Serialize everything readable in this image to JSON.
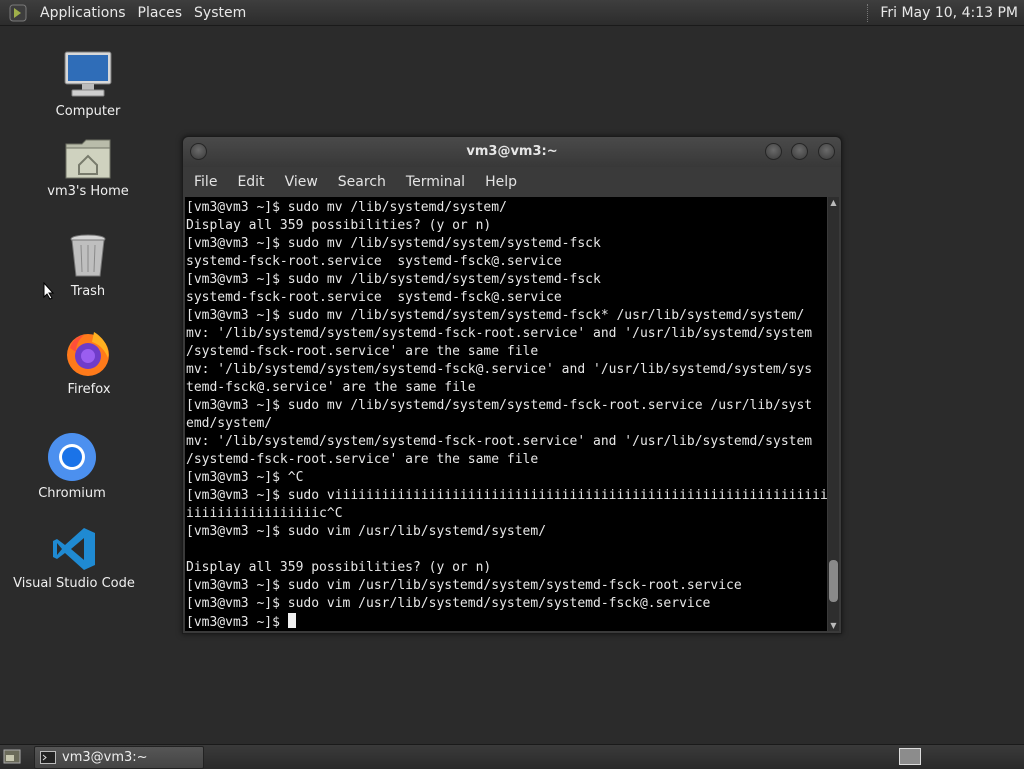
{
  "top_panel": {
    "menus": [
      "Applications",
      "Places",
      "System"
    ],
    "clock": "Fri May 10,  4:13 PM"
  },
  "desktop_icons": [
    {
      "label": "Computer",
      "icon": "computer-icon"
    },
    {
      "label": "vm3's Home",
      "icon": "home-folder-icon"
    },
    {
      "label": "Trash",
      "icon": "trash-icon"
    },
    {
      "label": "Firefox",
      "icon": "firefox-icon"
    },
    {
      "label": "Chromium",
      "icon": "chromium-icon"
    },
    {
      "label": "Visual Studio Code",
      "icon": "vscode-icon"
    }
  ],
  "terminal": {
    "title": "vm3@vm3:~",
    "menus": [
      "File",
      "Edit",
      "View",
      "Search",
      "Terminal",
      "Help"
    ],
    "content": "[vm3@vm3 ~]$ sudo mv /lib/systemd/system/\nDisplay all 359 possibilities? (y or n)\n[vm3@vm3 ~]$ sudo mv /lib/systemd/system/systemd-fsck\nsystemd-fsck-root.service  systemd-fsck@.service\n[vm3@vm3 ~]$ sudo mv /lib/systemd/system/systemd-fsck\nsystemd-fsck-root.service  systemd-fsck@.service\n[vm3@vm3 ~]$ sudo mv /lib/systemd/system/systemd-fsck* /usr/lib/systemd/system/\nmv: '/lib/systemd/system/systemd-fsck-root.service' and '/usr/lib/systemd/system\n/systemd-fsck-root.service' are the same file\nmv: '/lib/systemd/system/systemd-fsck@.service' and '/usr/lib/systemd/system/sys\ntemd-fsck@.service' are the same file\n[vm3@vm3 ~]$ sudo mv /lib/systemd/system/systemd-fsck-root.service /usr/lib/syst\nemd/system/\nmv: '/lib/systemd/system/systemd-fsck-root.service' and '/usr/lib/systemd/system\n/systemd-fsck-root.service' are the same file\n[vm3@vm3 ~]$ ^C\n[vm3@vm3 ~]$ sudo viiiiiiiiiiiiiiiiiiiiiiiiiiiiiiiiiiiiiiiiiiiiiiiiiiiiiiiiiiiiiiiii\niiiiiiiiiiiiiiiiic^C\n[vm3@vm3 ~]$ sudo vim /usr/lib/systemd/system/\n\nDisplay all 359 possibilities? (y or n)\n[vm3@vm3 ~]$ sudo vim /usr/lib/systemd/system/systemd-fsck-root.service\n[vm3@vm3 ~]$ sudo vim /usr/lib/systemd/system/systemd-fsck@.service\n[vm3@vm3 ~]$ ",
    "scrollbar_position": 0.95
  },
  "bottom_panel": {
    "task_label": "vm3@vm3:~"
  }
}
